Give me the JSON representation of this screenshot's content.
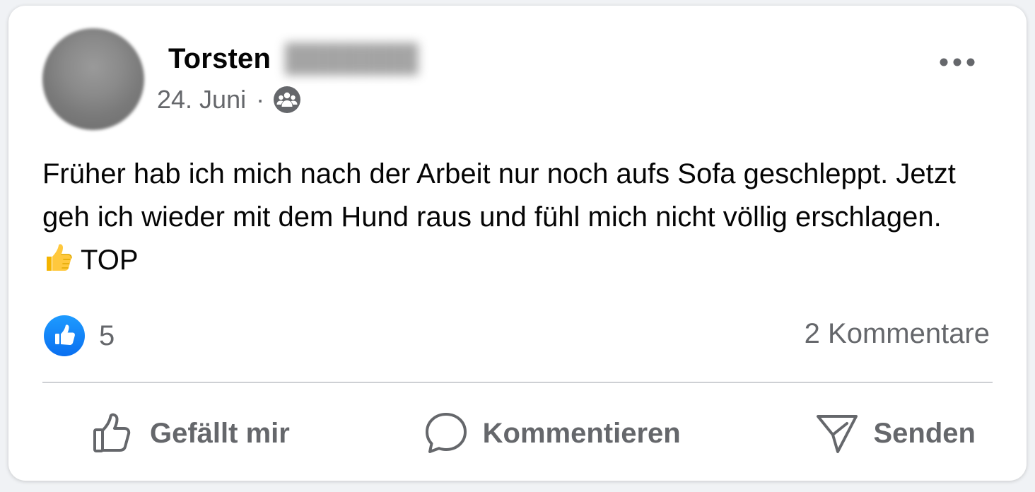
{
  "post": {
    "author_first_name": "Torsten",
    "author_last_name_redacted": "███████",
    "date": "24. Juni",
    "meta_separator": "·",
    "audience_icon": "group-icon",
    "text_before_emoji": "Früher hab ich mich nach der Arbeit nur noch aufs Sofa geschleppt. Jetzt geh ich wieder mit dem Hund raus und fühl mich nicht völlig erschlagen.",
    "emoji": "thumbs-up-emoji",
    "text_after_emoji": "TOP"
  },
  "stats": {
    "reaction_icon": "like-icon",
    "reaction_count": "5",
    "comments": "2 Kommentare"
  },
  "actions": {
    "like_label": "Gefällt mir",
    "comment_label": "Kommentieren",
    "send_label": "Senden"
  },
  "colors": {
    "text_primary": "#050505",
    "text_secondary": "#65676b",
    "like_blue": "#0a6ff0",
    "divider": "#ced0d4"
  }
}
